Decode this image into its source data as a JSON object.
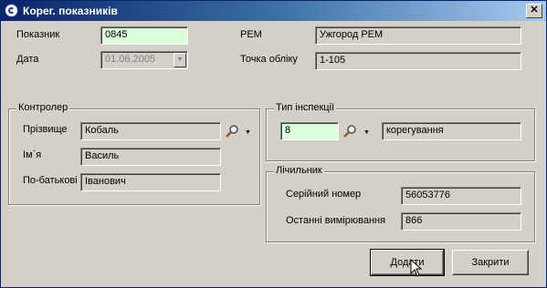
{
  "window": {
    "title": "Корег. показників"
  },
  "fields": {
    "pokaznyk_label": "Показник",
    "pokaznyk_value": "0845",
    "data_label": "Дата",
    "data_value": "01.06.2005",
    "rem_label": "РЕМ",
    "rem_value": "Ужгород РЕМ",
    "tochka_label": "Точка обліку",
    "tochka_value": "1-105"
  },
  "kontroler": {
    "legend": "Контролер",
    "surname_label": "Прізвище",
    "surname_value": "Кобаль",
    "name_label": "Ім`я",
    "name_value": "Василь",
    "patronymic_label": "По-батькові",
    "patronymic_value": "Іванович"
  },
  "inspection": {
    "legend": "Тип інспекції",
    "code": "8",
    "type": "корегування"
  },
  "meter": {
    "legend": "Лічильник",
    "serial_label": "Серійний номер",
    "serial_value": "56053776",
    "last_label": "Останні вимірювання",
    "last_value": "866"
  },
  "buttons": {
    "add": "Додати",
    "close": "Закрити"
  },
  "titlebar": {
    "close_glyph": "✕"
  },
  "glyphs": {
    "dropdown": "▼",
    "small_down": "▼"
  },
  "icons": {
    "app": "app-icon",
    "search": "search-icon",
    "close": "close-icon",
    "cursor": "mouse-cursor-icon"
  }
}
